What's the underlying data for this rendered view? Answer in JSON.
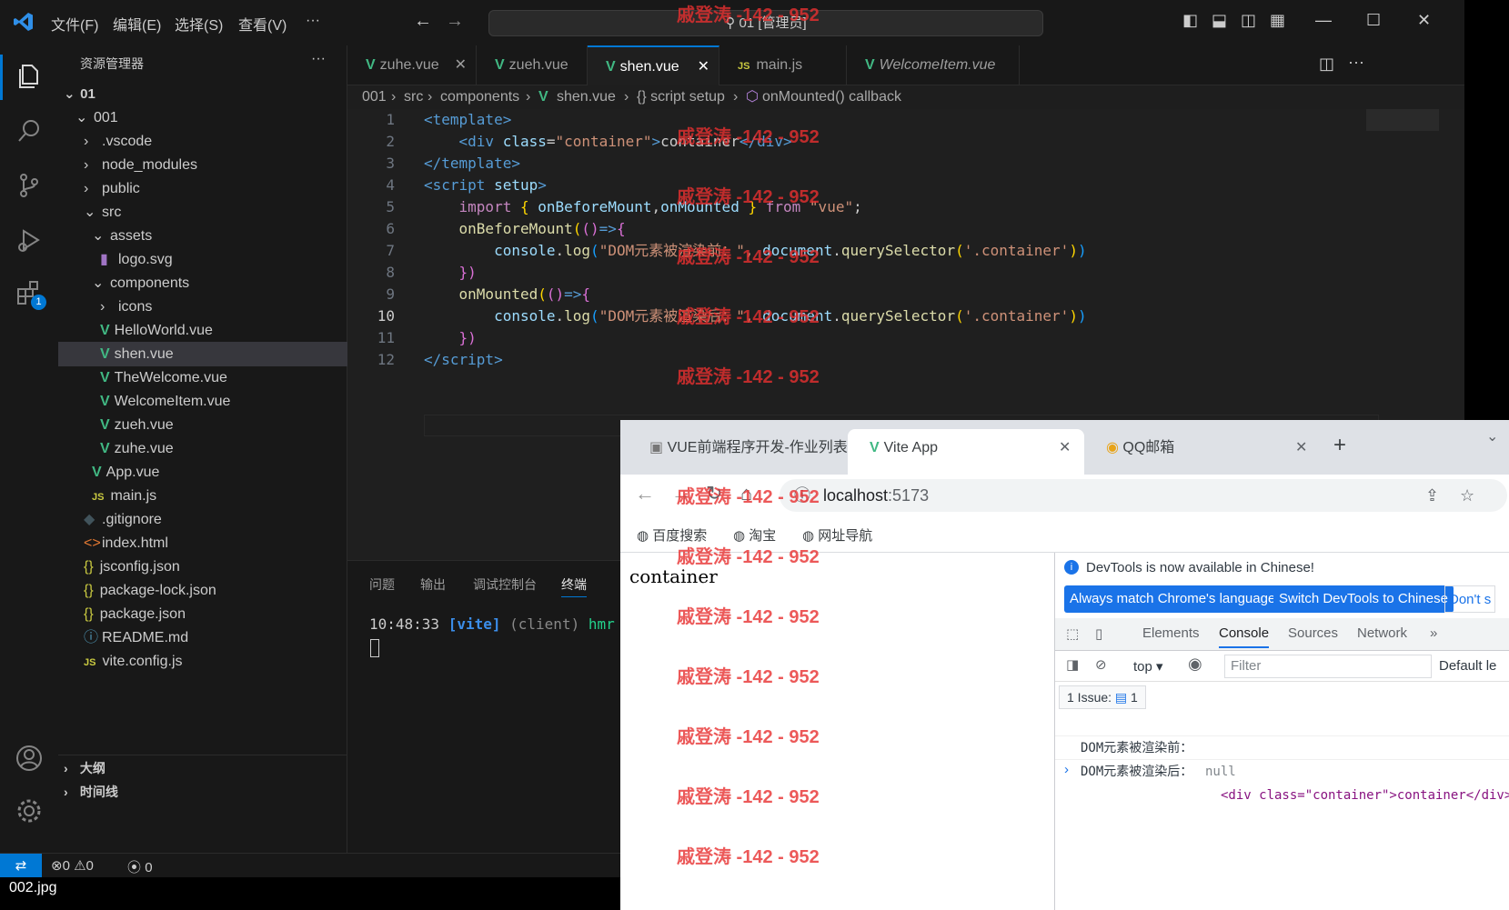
{
  "titlebar": {
    "menus": [
      "文件(F)",
      "编辑(E)",
      "选择(S)",
      "查看(V)",
      "···"
    ],
    "command_center": "01 [管理员]"
  },
  "sidebar": {
    "title": "资源管理器",
    "more": "···",
    "root": "01",
    "tree": [
      {
        "label": "001",
        "indent": 1,
        "type": "folder-open"
      },
      {
        "label": ".vscode",
        "indent": 2,
        "type": "folder"
      },
      {
        "label": "node_modules",
        "indent": 2,
        "type": "folder"
      },
      {
        "label": "public",
        "indent": 2,
        "type": "folder"
      },
      {
        "label": "src",
        "indent": 2,
        "type": "folder-open"
      },
      {
        "label": "assets",
        "indent": 3,
        "type": "folder-open"
      },
      {
        "label": "logo.svg",
        "indent": 4,
        "type": "svg"
      },
      {
        "label": "components",
        "indent": 3,
        "type": "folder-open"
      },
      {
        "label": "icons",
        "indent": 4,
        "type": "folder"
      },
      {
        "label": "HelloWorld.vue",
        "indent": 4,
        "type": "vue"
      },
      {
        "label": "shen.vue",
        "indent": 4,
        "type": "vue",
        "selected": true
      },
      {
        "label": "TheWelcome.vue",
        "indent": 4,
        "type": "vue"
      },
      {
        "label": "WelcomeItem.vue",
        "indent": 4,
        "type": "vue"
      },
      {
        "label": "zueh.vue",
        "indent": 4,
        "type": "vue"
      },
      {
        "label": "zuhe.vue",
        "indent": 4,
        "type": "vue"
      },
      {
        "label": "App.vue",
        "indent": 3,
        "type": "vue"
      },
      {
        "label": "main.js",
        "indent": 3,
        "type": "js"
      },
      {
        "label": ".gitignore",
        "indent": 2,
        "type": "git"
      },
      {
        "label": "index.html",
        "indent": 2,
        "type": "html"
      },
      {
        "label": "jsconfig.json",
        "indent": 2,
        "type": "json"
      },
      {
        "label": "package-lock.json",
        "indent": 2,
        "type": "json"
      },
      {
        "label": "package.json",
        "indent": 2,
        "type": "json"
      },
      {
        "label": "README.md",
        "indent": 2,
        "type": "info"
      },
      {
        "label": "vite.config.js",
        "indent": 2,
        "type": "js"
      }
    ],
    "outline": "大纲",
    "timeline": "时间线"
  },
  "tabs": [
    {
      "label": "zuhe.vue",
      "type": "vue"
    },
    {
      "label": "zueh.vue",
      "type": "vue"
    },
    {
      "label": "shen.vue",
      "type": "vue",
      "active": true
    },
    {
      "label": "main.js",
      "type": "js"
    },
    {
      "label": "WelcomeItem.vue",
      "type": "vue"
    }
  ],
  "breadcrumb": [
    "001",
    "src",
    "components",
    "shen.vue",
    "{} script setup",
    "onMounted() callback"
  ],
  "editor": {
    "lines": [
      "1",
      "2",
      "3",
      "4",
      "5",
      "6",
      "7",
      "8",
      "9",
      "10",
      "11",
      "12"
    ],
    "current_line": "10"
  },
  "panel": {
    "tabs": [
      "问题",
      "输出",
      "调试控制台",
      "终端"
    ],
    "active": "终端",
    "terminal": {
      "time": "10:48:33",
      "tag": "[vite]",
      "client": "(client)",
      "msg": "hmr u"
    }
  },
  "status": {
    "errors": "0",
    "warnings": "0",
    "ports": "0"
  },
  "bottom_label": "002.jpg",
  "chrome": {
    "tabs": [
      {
        "label": "VUE前端程序开发-作业列表"
      },
      {
        "label": "Vite App",
        "active": true
      },
      {
        "label": "QQ邮箱"
      }
    ],
    "url_host": "localhost",
    "url_port": ":5173",
    "bookmarks": [
      "百度搜索",
      "淘宝",
      "网址导航"
    ],
    "page_text": "container",
    "devtools": {
      "banner": "DevTools is now available in Chinese!",
      "btn1": "Always match Chrome's language",
      "btn2": "Switch DevTools to Chinese",
      "btn3": "Don't s",
      "tabs": [
        "Elements",
        "Console",
        "Sources",
        "Network"
      ],
      "active_tab": "Console",
      "context": "top",
      "filter_placeholder": "Filter",
      "levels": "Default le",
      "issues": "1 Issue:",
      "issues_count": "1",
      "logs": [
        {
          "label": "DOM元素被渲染前：",
          "value": "null"
        },
        {
          "label": "DOM元素被渲染后：",
          "value": "<div class=\"container\">container</div>"
        }
      ]
    }
  },
  "watermark": "戚登涛 -142 - 952"
}
